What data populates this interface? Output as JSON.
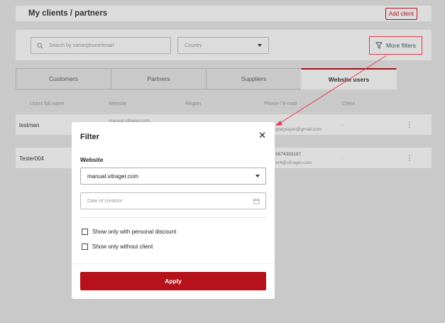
{
  "header": {
    "title": "My clients / partners",
    "add_client_label": "Add client"
  },
  "filters": {
    "search_placeholder": "Search by name/phone/email",
    "country_placeholder": "Country",
    "more_filters_label": "More filters"
  },
  "tabs": [
    {
      "label": "Customers"
    },
    {
      "label": "Partners"
    },
    {
      "label": "Suppliers"
    },
    {
      "label": "Website users"
    }
  ],
  "table": {
    "columns": [
      "Users full name",
      "Website",
      "Region",
      "Phone / E-mail",
      "Client"
    ],
    "rows": [
      {
        "name": "testman",
        "website": "manual.vitrager.com",
        "email": "gtarplayer@gmail.com",
        "client": "-"
      },
      {
        "name": "Tester004",
        "phone": "0674333197",
        "email": "er4@vitrager.com",
        "client": "-"
      }
    ]
  },
  "modal": {
    "title": "Filter",
    "section_label": "Website",
    "website_value": "manual.vitrager.com",
    "date_placeholder": "Date of creation",
    "option_discount": "Show only with personal discount",
    "option_no_client": "Show only without client",
    "apply_label": "Apply"
  },
  "colors": {
    "accent": "#b5121b",
    "highlight": "#e53948"
  }
}
